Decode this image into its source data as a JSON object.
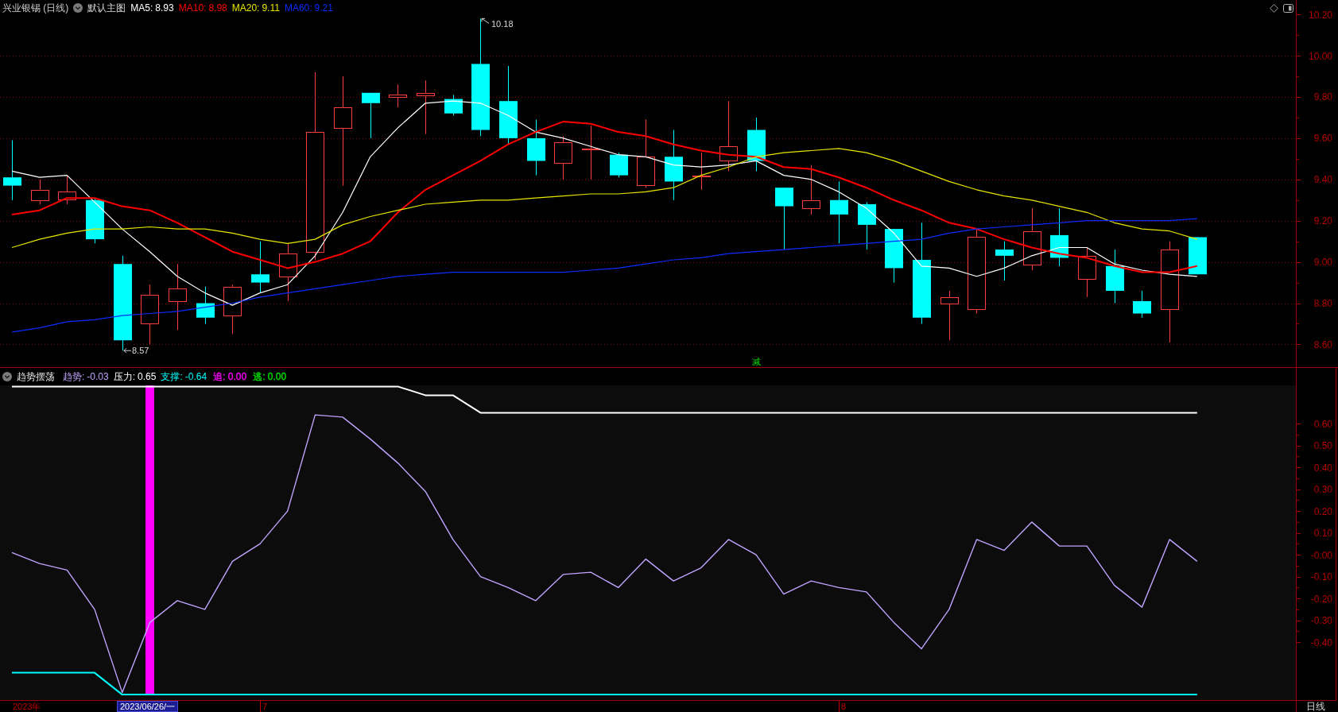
{
  "price_pane": {
    "title": "兴业银锡 (日线)",
    "template": "默认主图",
    "ma_values": [
      "8.93",
      "8.98",
      "9.11",
      "9.21"
    ],
    "chart_data": {
      "type": "line",
      "grid": true,
      "ylim": [
        8.49,
        10.27
      ],
      "yticks": [
        {
          "value": 10.2,
          "label": "10.20"
        },
        {
          "value": 10.0,
          "label": "10.00"
        },
        {
          "value": 9.8,
          "label": "9.80"
        },
        {
          "value": 9.6,
          "label": "9.60"
        },
        {
          "value": 9.4,
          "label": "9.40"
        },
        {
          "value": 9.2,
          "label": "9.20"
        },
        {
          "value": 9.0,
          "label": "9.00"
        },
        {
          "value": 8.8,
          "label": "8.80"
        },
        {
          "value": 8.6,
          "label": "8.60"
        }
      ],
      "series": [
        {
          "name": "MA5:",
          "color": "#ffffff",
          "values": [
            9.44,
            9.41,
            9.42,
            9.29,
            9.16,
            9.05,
            8.93,
            8.85,
            8.79,
            8.85,
            8.89,
            9.03,
            9.24,
            9.51,
            9.65,
            9.77,
            9.78,
            9.77,
            9.71,
            9.63,
            9.6,
            9.56,
            9.52,
            9.51,
            9.47,
            9.46,
            9.47,
            9.49,
            9.42,
            9.4,
            9.34,
            9.26,
            9.14,
            8.98,
            8.97,
            8.93,
            8.97,
            9.03,
            9.07,
            9.07,
            8.99,
            8.96,
            8.94,
            8.93
          ]
        },
        {
          "name": "MA10:",
          "color": "#ff0000",
          "values": [
            9.23,
            9.25,
            9.31,
            9.31,
            9.27,
            9.25,
            9.19,
            9.12,
            9.05,
            9.01,
            8.97,
            9.0,
            9.04,
            9.1,
            9.24,
            9.35,
            9.42,
            9.49,
            9.57,
            9.63,
            9.68,
            9.67,
            9.63,
            9.61,
            9.57,
            9.54,
            9.52,
            9.51,
            9.46,
            9.45,
            9.41,
            9.36,
            9.3,
            9.25,
            9.19,
            9.16,
            9.11,
            9.07,
            9.04,
            9.02,
            8.98,
            8.95,
            8.95,
            8.98
          ]
        },
        {
          "name": "MA20:",
          "color": "#e6e600",
          "values": [
            9.07,
            9.11,
            9.14,
            9.16,
            9.16,
            9.17,
            9.16,
            9.16,
            9.14,
            9.11,
            9.09,
            9.11,
            9.18,
            9.22,
            9.25,
            9.28,
            9.29,
            9.3,
            9.3,
            9.31,
            9.32,
            9.33,
            9.33,
            9.34,
            9.36,
            9.42,
            9.46,
            9.51,
            9.53,
            9.54,
            9.55,
            9.53,
            9.49,
            9.44,
            9.39,
            9.35,
            9.32,
            9.3,
            9.27,
            9.24,
            9.19,
            9.16,
            9.15,
            9.11
          ]
        },
        {
          "name": "MA60:",
          "color": "#0a2cff",
          "values": [
            8.66,
            8.68,
            8.71,
            8.72,
            8.74,
            8.75,
            8.76,
            8.78,
            8.8,
            8.83,
            8.85,
            8.87,
            8.89,
            8.91,
            8.93,
            8.94,
            8.95,
            8.95,
            8.95,
            8.95,
            8.95,
            8.96,
            8.97,
            8.99,
            9.01,
            9.02,
            9.04,
            9.05,
            9.06,
            9.07,
            9.08,
            9.09,
            9.1,
            9.11,
            9.14,
            9.16,
            9.17,
            9.18,
            9.19,
            9.2,
            9.2,
            9.2,
            9.2,
            9.21
          ]
        }
      ],
      "annotations": [
        "10.18",
        "8.57"
      ]
    },
    "signal_label": "减"
  },
  "indicator_pane": {
    "title": "趋势摆荡",
    "series_values": [
      "-0.03",
      "0.65",
      "-0.64"
    ],
    "signals": [
      {
        "label": "追: 0.00",
        "color": "#ff00ff"
      },
      {
        "label": "逃: 0.00",
        "color": "#00e000"
      }
    ],
    "chart_data": {
      "type": "line",
      "ylim": [
        -0.665,
        0.775
      ],
      "yticks": [
        {
          "value": 0.6,
          "label": "0.60"
        },
        {
          "value": 0.5,
          "label": "0.50"
        },
        {
          "value": 0.4,
          "label": "0.40"
        },
        {
          "value": 0.3,
          "label": "0.30"
        },
        {
          "value": 0.2,
          "label": "0.20"
        },
        {
          "value": 0.1,
          "label": "0.10"
        },
        {
          "value": 0,
          "label": "-0.00"
        },
        {
          "value": -0.1,
          "label": "-0.10"
        },
        {
          "value": -0.2,
          "label": "-0.20"
        },
        {
          "value": -0.3,
          "label": "-0.30"
        },
        {
          "value": -0.4,
          "label": "-0.40"
        }
      ],
      "series": [
        {
          "name": "趋势:",
          "color": "#c0a4ff",
          "values": [
            0.01,
            -0.04,
            -0.07,
            -0.25,
            -0.63,
            -0.31,
            -0.21,
            -0.25,
            -0.03,
            0.05,
            0.2,
            0.64,
            0.63,
            0.53,
            0.42,
            0.29,
            0.07,
            -0.1,
            -0.15,
            -0.21,
            -0.09,
            -0.08,
            -0.15,
            -0.02,
            -0.12,
            -0.06,
            0.07,
            0.0,
            -0.18,
            -0.12,
            -0.15,
            -0.17,
            -0.31,
            -0.43,
            -0.25,
            0.07,
            0.02,
            0.15,
            0.04,
            0.04,
            -0.14,
            -0.24,
            0.07,
            -0.03
          ]
        },
        {
          "name": "压力:",
          "color": "#ffffff",
          "values": [
            0.77,
            0.77,
            0.77,
            0.77,
            0.77,
            0.77,
            0.77,
            0.77,
            0.77,
            0.77,
            0.77,
            0.77,
            0.77,
            0.77,
            0.77,
            0.73,
            0.73,
            0.65,
            0.65,
            0.65,
            0.65,
            0.65,
            0.65,
            0.65,
            0.65,
            0.65,
            0.65,
            0.65,
            0.65,
            0.65,
            0.65,
            0.65,
            0.65,
            0.65,
            0.65,
            0.65,
            0.65,
            0.65,
            0.65,
            0.65,
            0.65,
            0.65,
            0.65,
            0.65
          ]
        },
        {
          "name": "支撑:",
          "color": "#00ffff",
          "values": [
            -0.54,
            -0.54,
            -0.54,
            -0.54,
            -0.64,
            -0.64,
            -0.64,
            -0.64,
            -0.64,
            -0.64,
            -0.64,
            -0.64,
            -0.64,
            -0.64,
            -0.64,
            -0.64,
            -0.64,
            -0.64,
            -0.64,
            -0.64,
            -0.64,
            -0.64,
            -0.64,
            -0.64,
            -0.64,
            -0.64,
            -0.64,
            -0.64,
            -0.64,
            -0.64,
            -0.64,
            -0.64,
            -0.64,
            -0.64,
            -0.64,
            -0.64,
            -0.64,
            -0.64,
            -0.64,
            -0.64,
            -0.64,
            -0.64,
            -0.64,
            -0.64
          ]
        }
      ]
    }
  },
  "time_axis": {
    "year_label": "2023年",
    "cursor_label": "2023/06/26/一",
    "month_labels": [
      "7",
      "8"
    ]
  },
  "period_label": "日线"
}
